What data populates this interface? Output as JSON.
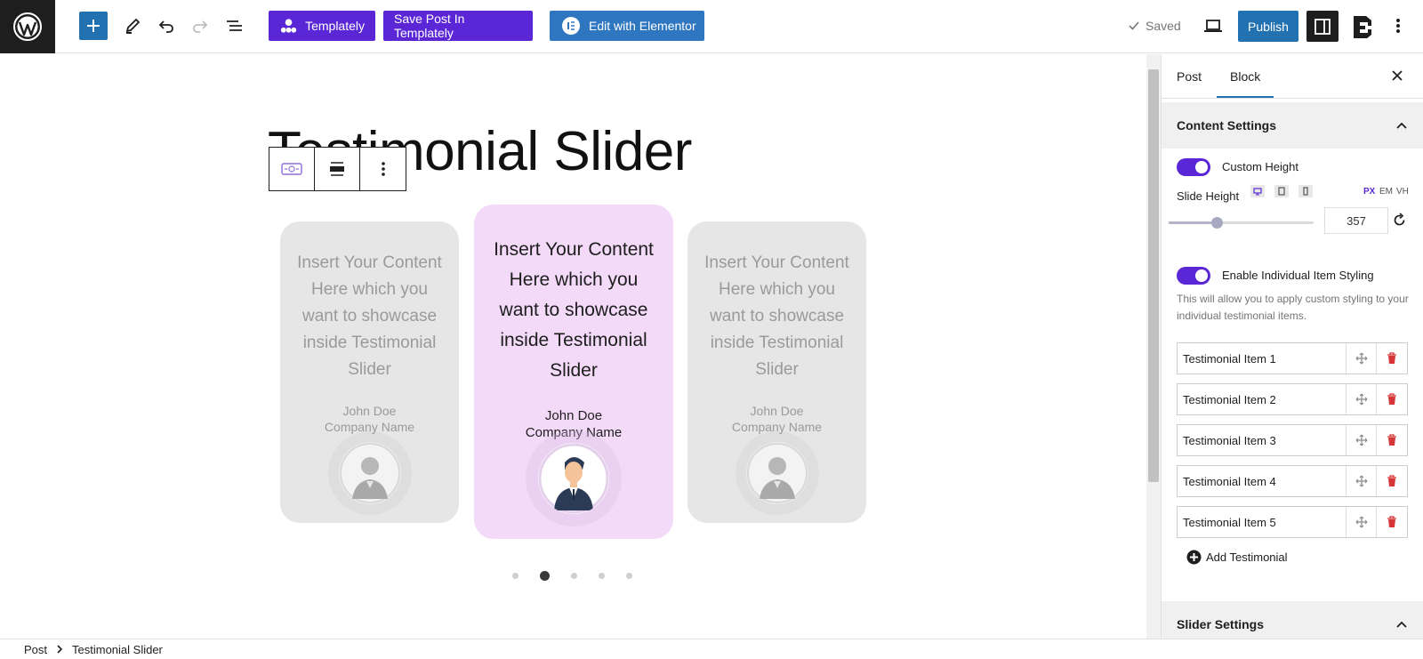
{
  "topbar": {
    "templately_label": "Templately",
    "save_templately_label": "Save Post In Templately",
    "elementor_label": "Edit with Elementor",
    "saved_label": "Saved",
    "publish_label": "Publish"
  },
  "canvas": {
    "title": "Testimonial Slider",
    "cards": [
      {
        "content": "Insert Your Content Here which you want to showcase inside Testimonial Slider",
        "name": "John Doe",
        "company": "Company Name"
      },
      {
        "content": "Insert Your Content Here which you want to showcase inside Testimonial Slider",
        "name": "John Doe",
        "company": "Company Name"
      },
      {
        "content": "Insert Your Content Here which you want to showcase inside Testimonial Slider",
        "name": "John Doe",
        "company": "Company Name"
      }
    ],
    "active_dot": 2,
    "dot_count": 5
  },
  "panel": {
    "tabs": [
      "Post",
      "Block"
    ],
    "active_tab": "Block",
    "content_settings": "Content Settings",
    "custom_height_label": "Custom Height",
    "slide_height_label": "Slide Height",
    "units": [
      "PX",
      "EM",
      "VH"
    ],
    "active_unit": "PX",
    "slide_height_value": "357",
    "slider_fraction": 0.33,
    "individual_label": "Enable Individual Item Styling",
    "individual_help": "This will allow you to apply custom styling to your individual testimonial items.",
    "items": [
      "Testimonial Item 1",
      "Testimonial Item 2",
      "Testimonial Item 3",
      "Testimonial Item 4",
      "Testimonial Item 5"
    ],
    "add_label": "Add Testimonial",
    "slider_settings": "Slider Settings"
  },
  "breadcrumb": {
    "root": "Post",
    "current": "Testimonial Slider"
  },
  "colors": {
    "accent": "#5b27d6",
    "wp_blue": "#2271b1",
    "card_center": "#f2daf8",
    "card_side": "#e6e6e6",
    "delete": "#d63638"
  }
}
